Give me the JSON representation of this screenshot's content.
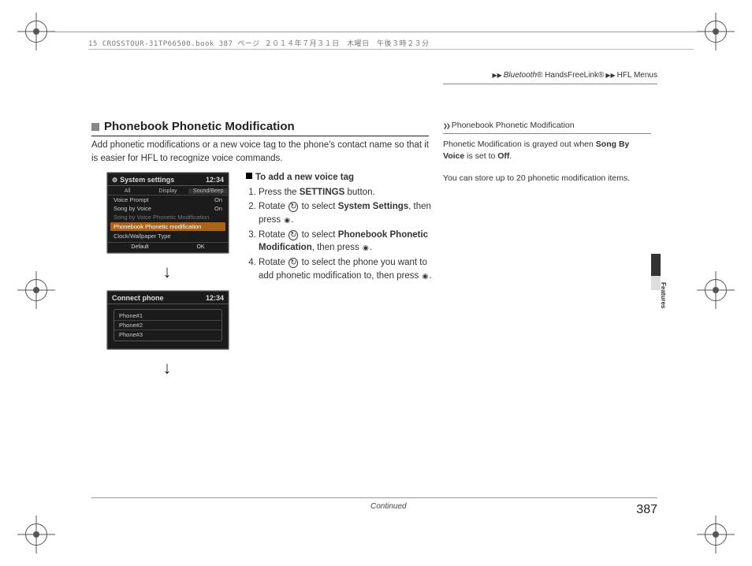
{
  "bookinfo": "15 CROSSTOUR-31TP66500.book  387 ページ  ２０１４年７月３１日　木曜日　午後３時２３分",
  "breadcrumb": {
    "a": "Bluetooth",
    "a_suffix": "® HandsFreeLink®",
    "b": "HFL Menus"
  },
  "section_title": "Phonebook Phonetic Modification",
  "intro": "Add phonetic modifications or a new voice tag to the phone's contact name so that it is easier for HFL to recognize voice commands.",
  "steps": {
    "heading": "To add a new voice tag",
    "s1_a": "Press the ",
    "s1_b": "SETTINGS",
    "s1_c": " button.",
    "s2_a": "Rotate ",
    "s2_b": " to select ",
    "s2_c": "System Settings",
    "s2_d": ", then press ",
    "s2_e": ".",
    "s3_a": "Rotate ",
    "s3_b": " to select ",
    "s3_c": "Phonebook Phonetic Modification",
    "s3_d": ", then press ",
    "s3_e": ".",
    "s4_a": "Rotate ",
    "s4_b": " to select the phone you want to add phonetic modification to, then press ",
    "s4_c": "."
  },
  "screen1": {
    "title": "System settings",
    "time": "12:34",
    "tab_all": "All",
    "tab_display": "Display",
    "tab_sound": "Sound/Beep",
    "row_voice_prompt": "Voice Prompt",
    "row_voice_prompt_val": "On",
    "row_sbv": "Song by Voice",
    "row_sbv_val": "On",
    "row_sbv_pm": "Song by Voice Phonetic Modification",
    "row_hl": "Phonebook Phonetic modification",
    "row_clock": "Clock/Wallpaper Type",
    "ftr_default": "Default",
    "ftr_ok": "OK"
  },
  "screen2": {
    "title": "Connect phone",
    "time": "12:34",
    "p1": "Phone#1",
    "p2": "Phone#2",
    "p3": "Phone#3"
  },
  "sidenote": {
    "title": "Phonebook Phonetic Modification",
    "p1_a": "Phonetic Modification is grayed out when ",
    "p1_b": "Song By Voice",
    "p1_c": " is set to ",
    "p1_d": "Off",
    "p1_e": ".",
    "p2": "You can store up to 20 phonetic modification items."
  },
  "side_tab_label": "Features",
  "continued": "Continued",
  "page_number": "387"
}
